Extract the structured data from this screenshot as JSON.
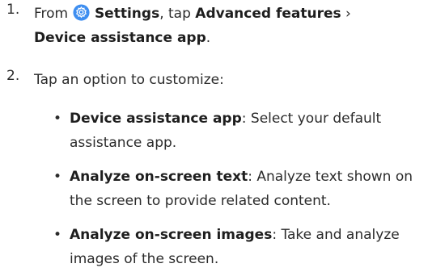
{
  "steps": [
    {
      "number": "1.",
      "text_from": "From",
      "settings_label": "Settings",
      "text_tap": ", tap",
      "advanced_label": "Advanced features",
      "separator": " ›",
      "device_app_label": "Device assistance app",
      "end": "."
    },
    {
      "number": "2.",
      "text": "Tap an option to customize:"
    }
  ],
  "options": [
    {
      "bullet": "•",
      "term": "Device assistance app",
      "description": ": Select your default assistance app."
    },
    {
      "bullet": "•",
      "term": "Analyze on-screen text",
      "description": ": Analyze text shown on the screen to provide related content."
    },
    {
      "bullet": "•",
      "term": "Analyze on-screen images",
      "description": ": Take and analyze images of the screen."
    }
  ],
  "icons": {
    "settings": "gear-icon"
  },
  "colors": {
    "settings_icon_bg": "#3e8ef0",
    "text": "#2b2b2b"
  }
}
